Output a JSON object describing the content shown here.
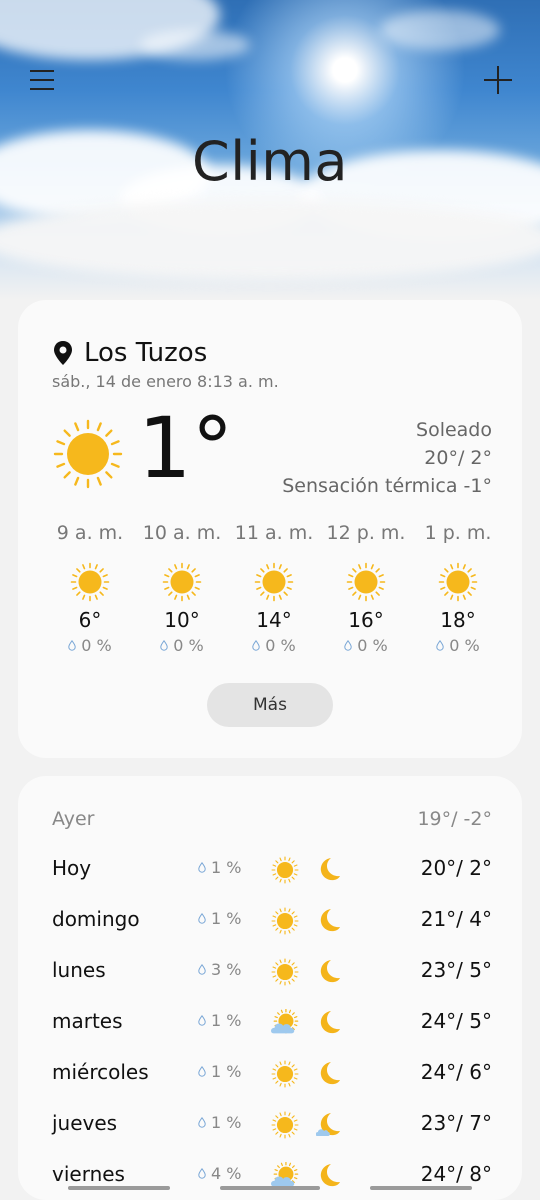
{
  "header": {
    "title": "Clima",
    "menu_icon": "hamburger-menu-icon",
    "add_icon": "plus-icon"
  },
  "current": {
    "location": "Los Tuzos",
    "datetime": "sáb., 14 de enero 8:13 a. m.",
    "temperature": "1°",
    "condition": "Soleado",
    "high_low": "20°/ 2°",
    "feels_like": "Sensación térmica -1°",
    "icon": "sunny-icon",
    "more_label": "Más"
  },
  "hourly": [
    {
      "time": "9 a. m.",
      "temp": "6°",
      "precip": "0 %",
      "icon": "sunny-icon"
    },
    {
      "time": "10 a. m.",
      "temp": "10°",
      "precip": "0 %",
      "icon": "sunny-icon"
    },
    {
      "time": "11 a. m.",
      "temp": "14°",
      "precip": "0 %",
      "icon": "sunny-icon"
    },
    {
      "time": "12 p. m.",
      "temp": "16°",
      "precip": "0 %",
      "icon": "sunny-icon"
    },
    {
      "time": "1 p. m.",
      "temp": "18°",
      "precip": "0 %",
      "icon": "sunny-icon"
    }
  ],
  "forecast": {
    "yesterday": {
      "label": "Ayer",
      "temps": "19°/ -2°"
    },
    "days": [
      {
        "name": "Hoy",
        "precip": "1 %",
        "temps": "20°/ 2°",
        "day_icon": "sunny-icon",
        "night_icon": "moon-icon"
      },
      {
        "name": "domingo",
        "precip": "1 %",
        "temps": "21°/ 4°",
        "day_icon": "sunny-icon",
        "night_icon": "moon-icon"
      },
      {
        "name": "lunes",
        "precip": "3 %",
        "temps": "23°/ 5°",
        "day_icon": "sunny-icon",
        "night_icon": "moon-icon"
      },
      {
        "name": "martes",
        "precip": "1 %",
        "temps": "24°/ 5°",
        "day_icon": "partly-cloudy-icon",
        "night_icon": "moon-icon"
      },
      {
        "name": "miércoles",
        "precip": "1 %",
        "temps": "24°/ 6°",
        "day_icon": "sunny-icon",
        "night_icon": "moon-icon"
      },
      {
        "name": "jueves",
        "precip": "1 %",
        "temps": "23°/ 7°",
        "day_icon": "sunny-icon",
        "night_icon": "moon-cloud-icon"
      },
      {
        "name": "viernes",
        "precip": "4 %",
        "temps": "24°/ 8°",
        "day_icon": "partly-cloudy-icon",
        "night_icon": "moon-icon"
      }
    ]
  },
  "colors": {
    "sun": "#f6b81c",
    "sun_ray": "#f6b81c",
    "moon": "#f4b41a",
    "cloud": "#9ec9ee",
    "card_bg": "#fafafa",
    "page_bg": "#f2f2f2"
  }
}
